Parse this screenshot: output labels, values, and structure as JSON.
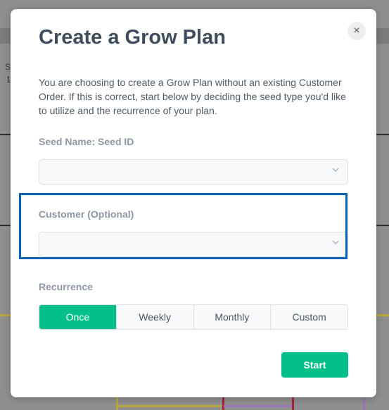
{
  "background": {
    "col_a": "S",
    "col_b": "1"
  },
  "dialog": {
    "title": "Create a Grow Plan",
    "close_glyph": "×",
    "intro": "You are choosing to create a Grow Plan without an existing Customer Order. If this is correct, start below by deciding the seed type you'd like to utilize and the recurrence of your plan.",
    "seed": {
      "label": "Seed Name: Seed ID",
      "value": ""
    },
    "customer": {
      "label": "Customer (Optional)",
      "value": ""
    },
    "recurrence": {
      "label": "Recurrence",
      "options": [
        "Once",
        "Weekly",
        "Monthly",
        "Custom"
      ],
      "selected": "Once"
    },
    "start_label": "Start"
  },
  "icons": {
    "close": "close-icon",
    "dropdown": "chevron-down-icon"
  },
  "colors": {
    "accent": "#03c08a",
    "title": "#3e4c5e",
    "highlight": "#0b63b8"
  }
}
